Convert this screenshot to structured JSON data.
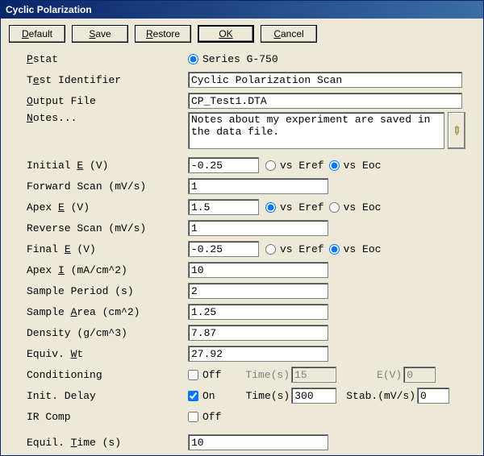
{
  "window": {
    "title": "Cyclic Polarization"
  },
  "toolbar": {
    "default_label": "Default",
    "save_label": "Save",
    "restore_label": "Restore",
    "ok_label": "OK",
    "cancel_label": "Cancel"
  },
  "labels": {
    "pstat": "Pstat",
    "test_id": "Test Identifier",
    "output_file": "Output File",
    "notes": "Notes...",
    "initial_e": "Initial E (V)",
    "forward_scan": "Forward Scan (mV/s)",
    "apex_e": "Apex E (V)",
    "reverse_scan": "Reverse Scan (mV/s)",
    "final_e": "Final E (V)",
    "apex_i": "Apex I (mA/cm^2)",
    "sample_period": "Sample Period (s)",
    "sample_area": "Sample Area (cm^2)",
    "density": "Density (g/cm^3)",
    "equiv_wt": "Equiv. Wt",
    "conditioning": "Conditioning",
    "init_delay": "Init. Delay",
    "ir_comp": "IR Comp",
    "equil_time": "Equil. Time (s)",
    "vs_eref": "vs Eref",
    "vs_eoc": "vs Eoc",
    "off": "Off",
    "on": "On",
    "time_s": "Time(s)",
    "ev": "E(V)",
    "stab": "Stab.(mV/s)"
  },
  "pstat": {
    "option1": "Series G-750",
    "selected": "Series G-750"
  },
  "fields": {
    "test_id": "Cyclic Polarization Scan",
    "output_file": "CP_Test1.DTA",
    "notes": "Notes about my experiment are saved in the data file.",
    "initial_e": "-0.25",
    "initial_e_ref": "Eoc",
    "forward_scan": "1",
    "apex_e": "1.5",
    "apex_e_ref": "Eref",
    "reverse_scan": "1",
    "final_e": "-0.25",
    "final_e_ref": "Eoc",
    "apex_i": "10",
    "sample_period": "2",
    "sample_area": "1.25",
    "density": "7.87",
    "equiv_wt": "27.92",
    "conditioning_on": false,
    "cond_time": "15",
    "cond_ev": "0",
    "init_delay_on": true,
    "initdelay_time": "300",
    "initdelay_stab": "0",
    "ir_comp_on": false,
    "equil_time": "10"
  }
}
